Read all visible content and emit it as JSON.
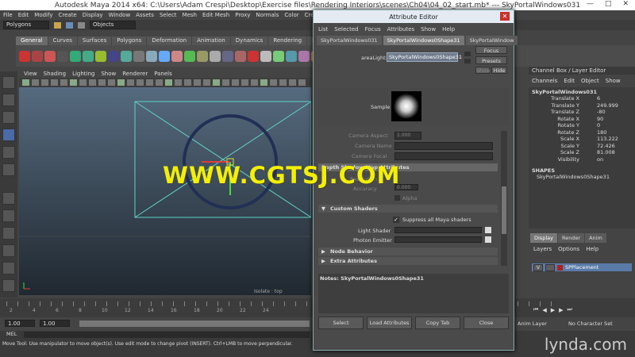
{
  "window": {
    "title": "Autodesk Maya 2014 x64: C:\\Users\\Adam Crespi\\Desktop\\Exercise files\\Rendering Interiors\\scenes\\Ch04\\04_02_start.mb*  ---  SkyPortalWindows031"
  },
  "menubar": [
    "File",
    "Edit",
    "Modify",
    "Create",
    "Display",
    "Window",
    "Assets",
    "Select",
    "Mesh",
    "Edit Mesh",
    "Proxy",
    "Normals",
    "Color",
    "Create UVs"
  ],
  "status": {
    "mode": "Polygons",
    "objects_label": "Objects"
  },
  "shelf_tabs": [
    "General",
    "Curves",
    "Surfaces",
    "Polygons",
    "Deformation",
    "Animation",
    "Dynamics",
    "Rendering",
    "PaintEffects"
  ],
  "viewport": {
    "menu": [
      "View",
      "Shading",
      "Lighting",
      "Show",
      "Renderer",
      "Panels"
    ],
    "label": "Isolate : top"
  },
  "timeline": {
    "ticks": [
      "2",
      "4",
      "6",
      "8",
      "10",
      "12",
      "14",
      "16",
      "18",
      "20",
      "22",
      "24"
    ]
  },
  "range": {
    "start": "1.00",
    "start2": "1.00",
    "anim_layer": "Anim Layer",
    "char_set": "No Character Set"
  },
  "mel": {
    "label": "MEL"
  },
  "help": {
    "text": "Move Tool: Use manipulator to move object(s). Use edit mode to change pivot (INSERT). Ctrl+LMB to move perpendicular."
  },
  "channel_box": {
    "title": "Channel Box / Layer Editor",
    "menu": [
      "Channels",
      "Edit",
      "Object",
      "Show"
    ],
    "object": "SkyPortalWindows031",
    "attrs": [
      {
        "name": "Translate X",
        "value": "6"
      },
      {
        "name": "Translate Y",
        "value": "249.999"
      },
      {
        "name": "Translate Z",
        "value": "-80"
      },
      {
        "name": "Rotate X",
        "value": "90"
      },
      {
        "name": "Rotate Y",
        "value": "0"
      },
      {
        "name": "Rotate Z",
        "value": "180"
      },
      {
        "name": "Scale X",
        "value": "113.222"
      },
      {
        "name": "Scale Y",
        "value": "72.426"
      },
      {
        "name": "Scale Z",
        "value": "81.008"
      },
      {
        "name": "Visibility",
        "value": "on"
      }
    ],
    "shapes_label": "SHAPES",
    "shape_name": "SkyPortalWindows0Shape31",
    "layer_tabs": [
      "Display",
      "Render",
      "Anim"
    ],
    "layer_menu": [
      "Layers",
      "Options",
      "Help"
    ],
    "layer_name": "SPPlacement",
    "layer_v": "V"
  },
  "attribute_editor": {
    "title": "Attribute Editor",
    "menu": [
      "List",
      "Selected",
      "Focus",
      "Attributes",
      "Show",
      "Help"
    ],
    "tabs": [
      "SkyPortalWindows031",
      "SkyPortalWindows0Shape31",
      "SkyPortalWindow"
    ],
    "area_light_label": "areaLight:",
    "area_light_value": "SkyPortalWindows0Shape31",
    "focus_btn": "Focus",
    "presets_btn": "Presets",
    "show_btn": "Show",
    "hide_btn": "Hide",
    "sample_label": "Sample",
    "camera_fields": [
      {
        "label": "Camera Aspect",
        "value": "1.000"
      },
      {
        "label": "Camera Name",
        "value": ""
      },
      {
        "label": "Camera Focal",
        "value": ""
      }
    ],
    "shadow_section": "Depth Shadow Map Attributes",
    "resolution_label": "Resolution",
    "accuracy_label": "Accuracy",
    "accuracy_value": "0.000",
    "alpha_label": "Alpha",
    "custom_shaders": "Custom Shaders",
    "suppress_label": "Suppress all Maya shaders",
    "light_shader_label": "Light Shader",
    "photon_emitter_label": "Photon Emitter",
    "node_behavior": "Node Behavior",
    "extra_attrs": "Extra Attributes",
    "notes": "Notes:  SkyPortalWindows0Shape31",
    "footer": [
      "Select",
      "Load Attributes",
      "Copy Tab",
      "Close"
    ]
  },
  "watermark": "WWW.CGTSJ.COM",
  "logo": "lynda.com",
  "colors": {
    "accent": "#5a7aa8",
    "watermark": "#f3f000"
  }
}
